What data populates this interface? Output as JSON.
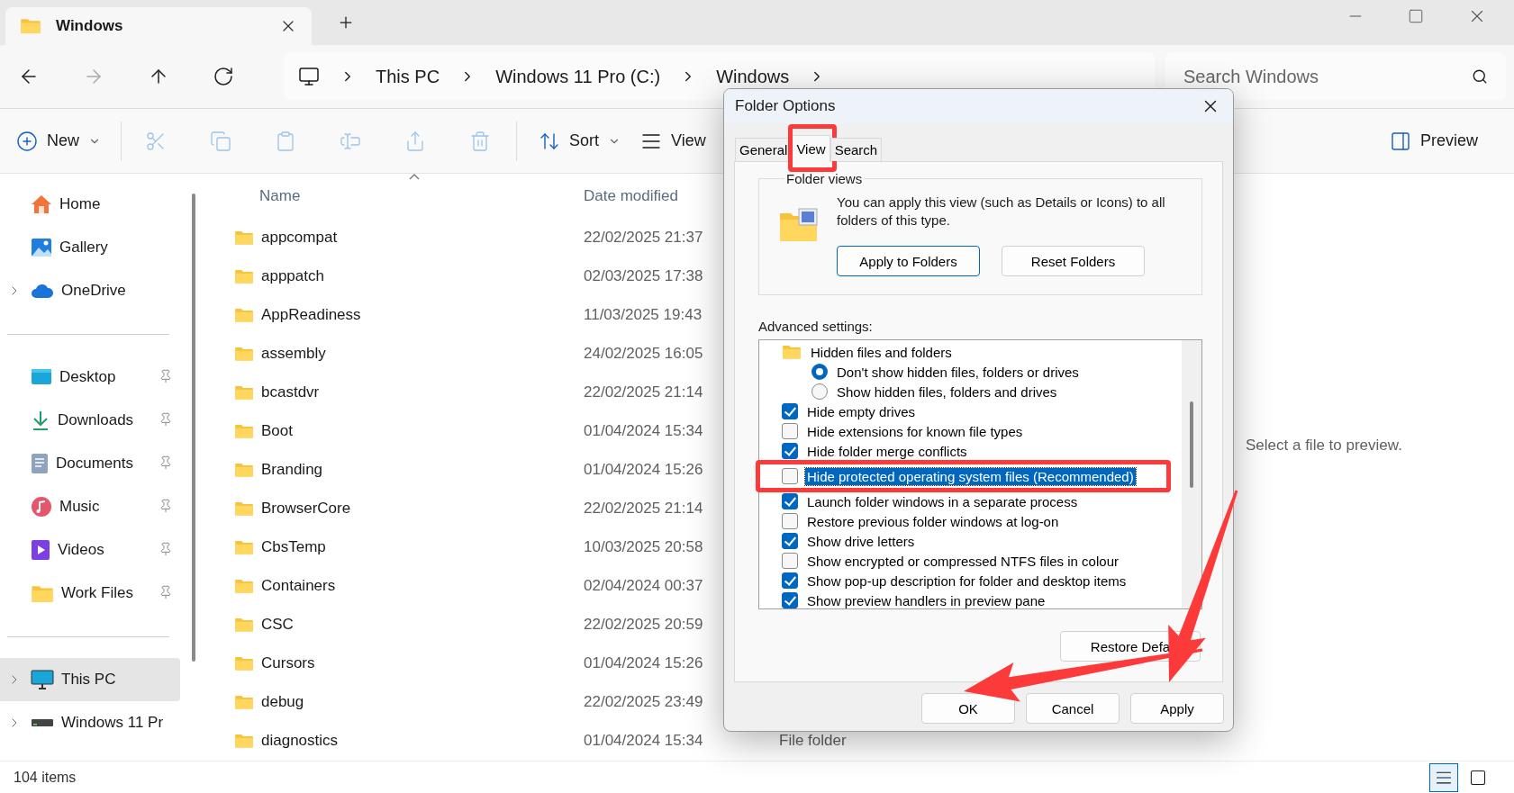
{
  "explorer_tab": {
    "title": "Windows",
    "selected": true
  },
  "navigation": [
    {
      "disabled": false
    },
    {
      "disabled": true
    },
    {
      "disabled": false
    },
    {
      "disabled": false
    }
  ],
  "breadcrumb": [
    "This PC",
    "Windows 11 Pro (C:)",
    "Windows"
  ],
  "search": {
    "placeholder": "Search Windows"
  },
  "command_bar": {
    "new": "New",
    "actions": [
      {
        "disabled": true
      },
      {
        "disabled": true
      },
      {
        "disabled": true
      },
      {
        "disabled": true
      },
      {
        "disabled": true
      },
      {
        "disabled": true
      }
    ],
    "sort": "Sort",
    "view": "View",
    "preview": "Preview"
  },
  "sidebar": {
    "groups": [
      [
        {
          "label": "Home",
          "selected": false
        },
        {
          "label": "Gallery",
          "selected": false
        },
        {
          "label": "OneDrive",
          "selected": false,
          "expanded": false
        }
      ],
      [
        {
          "label": "Desktop",
          "selected": false,
          "pinned": true
        },
        {
          "label": "Downloads",
          "selected": false,
          "pinned": true
        },
        {
          "label": "Documents",
          "selected": false,
          "pinned": true
        },
        {
          "label": "Music",
          "selected": false,
          "pinned": true
        },
        {
          "label": "Videos",
          "selected": false,
          "pinned": true
        },
        {
          "label": "Work Files",
          "selected": false,
          "pinned": true
        }
      ],
      [
        {
          "label": "This PC",
          "selected": true,
          "expanded": false
        },
        {
          "label": "Windows 11 Pr",
          "selected": false,
          "expanded": false
        }
      ]
    ]
  },
  "file_list": {
    "columns": [
      {
        "label": "Name",
        "sorted": true
      },
      {
        "label": "Date modified",
        "sorted": false
      }
    ],
    "rows": [
      {
        "name": "appcompat",
        "date_modified": "22/02/2025 21:37"
      },
      {
        "name": "apppatch",
        "date_modified": "02/03/2025 17:38"
      },
      {
        "name": "AppReadiness",
        "date_modified": "11/03/2025 19:43"
      },
      {
        "name": "assembly",
        "date_modified": "24/02/2025 16:05"
      },
      {
        "name": "bcastdvr",
        "date_modified": "22/02/2025 21:14"
      },
      {
        "name": "Boot",
        "date_modified": "01/04/2024 15:34"
      },
      {
        "name": "Branding",
        "date_modified": "01/04/2024 15:26"
      },
      {
        "name": "BrowserCore",
        "date_modified": "22/02/2025 21:14"
      },
      {
        "name": "CbsTemp",
        "date_modified": "10/03/2025 20:58"
      },
      {
        "name": "Containers",
        "date_modified": "02/04/2024 00:37"
      },
      {
        "name": "CSC",
        "date_modified": "22/02/2025 20:59"
      },
      {
        "name": "Cursors",
        "date_modified": "01/04/2024 15:26"
      },
      {
        "name": "debug",
        "date_modified": "22/02/2025 23:49"
      },
      {
        "name": "diagnostics",
        "date_modified": "01/04/2024 15:34",
        "type": "File folder"
      }
    ]
  },
  "preview_pane": {
    "message": "Select a file to preview."
  },
  "status_bar": {
    "item_count": "104 items",
    "view_modes": [
      {
        "selected": true
      },
      {
        "selected": false
      }
    ]
  },
  "dialog": {
    "title": "Folder Options",
    "tabs": [
      {
        "label": "General",
        "selected": false,
        "highlighted": false
      },
      {
        "label": "View",
        "selected": true,
        "highlighted": true
      },
      {
        "label": "Search",
        "selected": false,
        "highlighted": false
      }
    ],
    "folder_views": {
      "legend": "Folder views",
      "text": "You can apply this view (such as Details or Icons) to all folders of this type.",
      "buttons": [
        {
          "label": "Apply to Folders",
          "default": true
        },
        {
          "label": "Reset Folders",
          "default": false
        }
      ]
    },
    "advanced": {
      "label": "Advanced settings:",
      "items": [
        {
          "kind": "group",
          "label": "Hidden files and folders",
          "selected": false,
          "highlighted": false,
          "children": [
            {
              "kind": "radio",
              "label": "Don't show hidden files, folders or drives",
              "checked": true,
              "selected": false,
              "highlighted": false
            },
            {
              "kind": "radio",
              "label": "Show hidden files, folders and drives",
              "checked": false,
              "selected": false,
              "highlighted": false
            }
          ]
        },
        {
          "kind": "checkbox",
          "label": "Hide empty drives",
          "checked": true,
          "selected": false,
          "highlighted": false
        },
        {
          "kind": "checkbox",
          "label": "Hide extensions for known file types",
          "checked": false,
          "selected": false,
          "highlighted": false
        },
        {
          "kind": "checkbox",
          "label": "Hide folder merge conflicts",
          "checked": true,
          "selected": false,
          "highlighted": false
        },
        {
          "kind": "checkbox",
          "label": "Hide protected operating system files (Recommended)",
          "checked": false,
          "selected": true,
          "highlighted": true
        },
        {
          "kind": "checkbox",
          "label": "Launch folder windows in a separate process",
          "checked": true,
          "selected": false,
          "highlighted": false
        },
        {
          "kind": "checkbox",
          "label": "Restore previous folder windows at log-on",
          "checked": false,
          "selected": false,
          "highlighted": false
        },
        {
          "kind": "checkbox",
          "label": "Show drive letters",
          "checked": true,
          "selected": false,
          "highlighted": false
        },
        {
          "kind": "checkbox",
          "label": "Show encrypted or compressed NTFS files in colour",
          "checked": false,
          "selected": false,
          "highlighted": false
        },
        {
          "kind": "checkbox",
          "label": "Show pop-up description for folder and desktop items",
          "checked": true,
          "selected": false,
          "highlighted": false
        },
        {
          "kind": "checkbox",
          "label": "Show preview handlers in preview pane",
          "checked": true,
          "selected": false,
          "highlighted": false
        }
      ]
    },
    "restore_button": "Restore Defa",
    "buttons": [
      {
        "label": "OK"
      },
      {
        "label": "Cancel"
      },
      {
        "label": "Apply"
      }
    ]
  },
  "annotations": [
    {
      "kind": "arrow"
    },
    {
      "kind": "arrow"
    }
  ]
}
